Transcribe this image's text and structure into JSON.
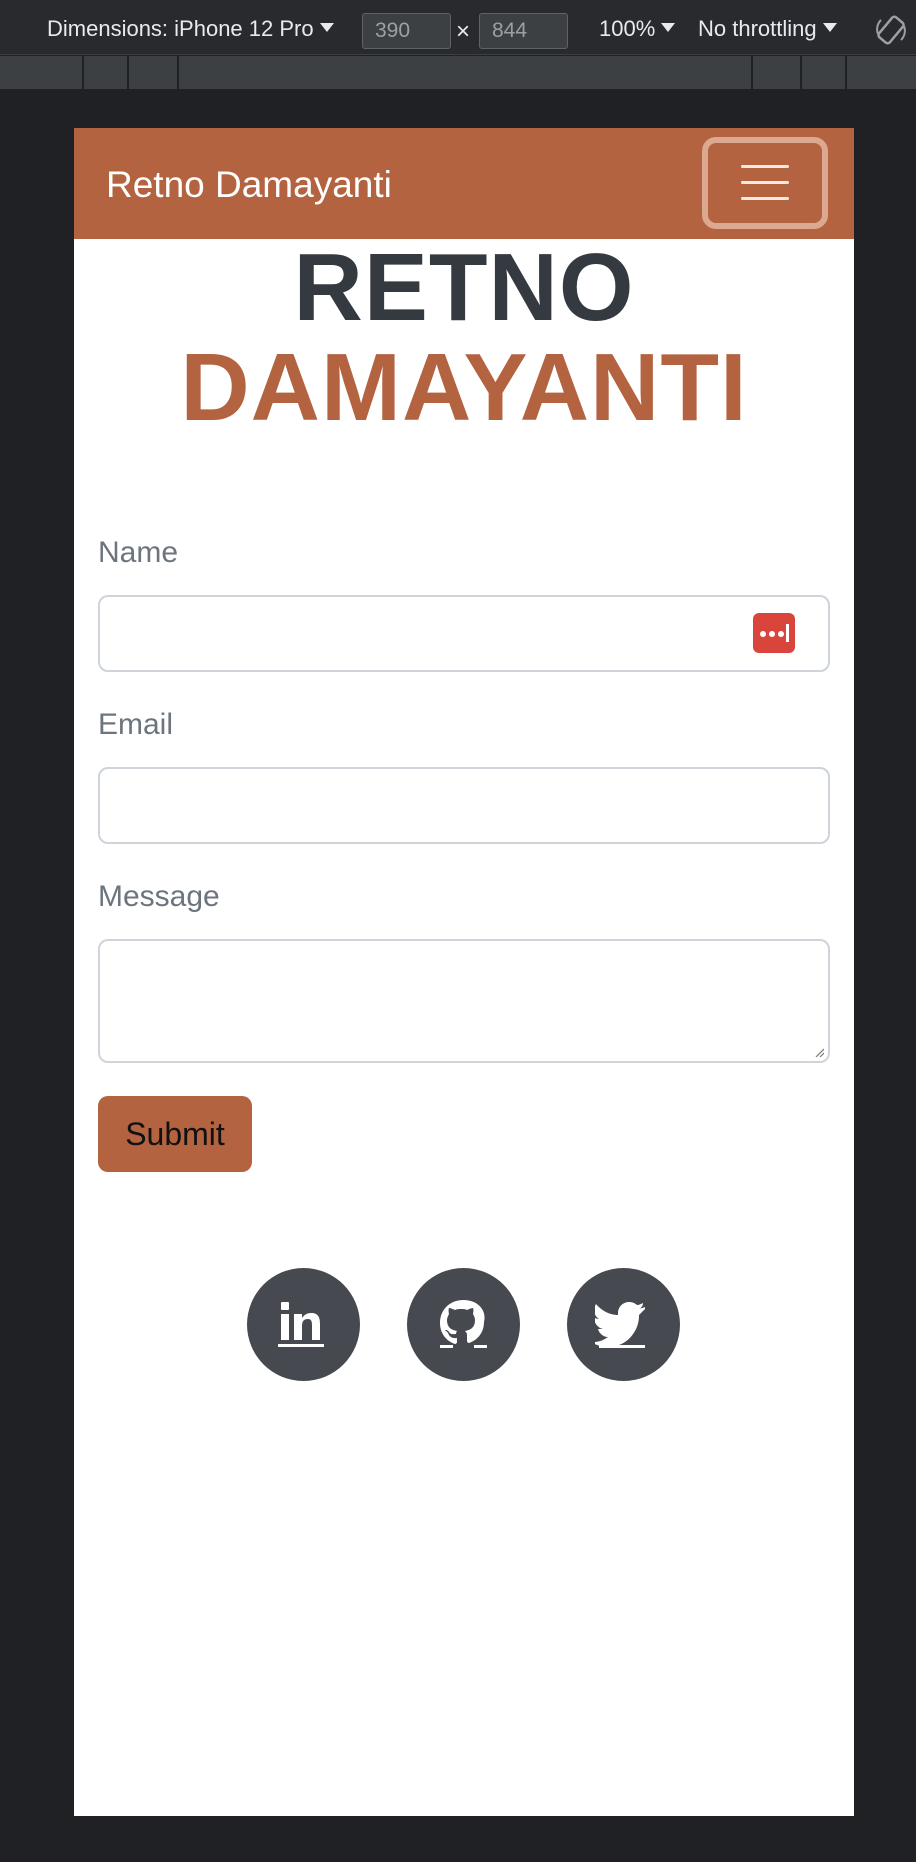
{
  "devtools": {
    "dimensions_label": "Dimensions: iPhone 12 Pro",
    "width_value": "390",
    "times": "×",
    "height_value": "844",
    "zoom": "100%",
    "throttling": "No throttling"
  },
  "navbar": {
    "brand": "Retno Damayanti",
    "toggler_icon": "hamburger-icon",
    "brand_color": "#b36340"
  },
  "hero": {
    "line1": "RETNO",
    "line2": "DAMAYANTI",
    "line1_color": "#343a40",
    "line2_color": "#b36340"
  },
  "form": {
    "name_label": "Name",
    "name_value": "",
    "email_label": "Email",
    "email_value": "",
    "message_label": "Message",
    "message_value": "",
    "submit_label": "Submit",
    "password_manager_icon": "lastpass-icon"
  },
  "social": [
    {
      "name": "LinkedIn",
      "icon": "linkedin-icon"
    },
    {
      "name": "GitHub",
      "icon": "github-icon"
    },
    {
      "name": "Twitter",
      "icon": "twitter-icon"
    }
  ]
}
